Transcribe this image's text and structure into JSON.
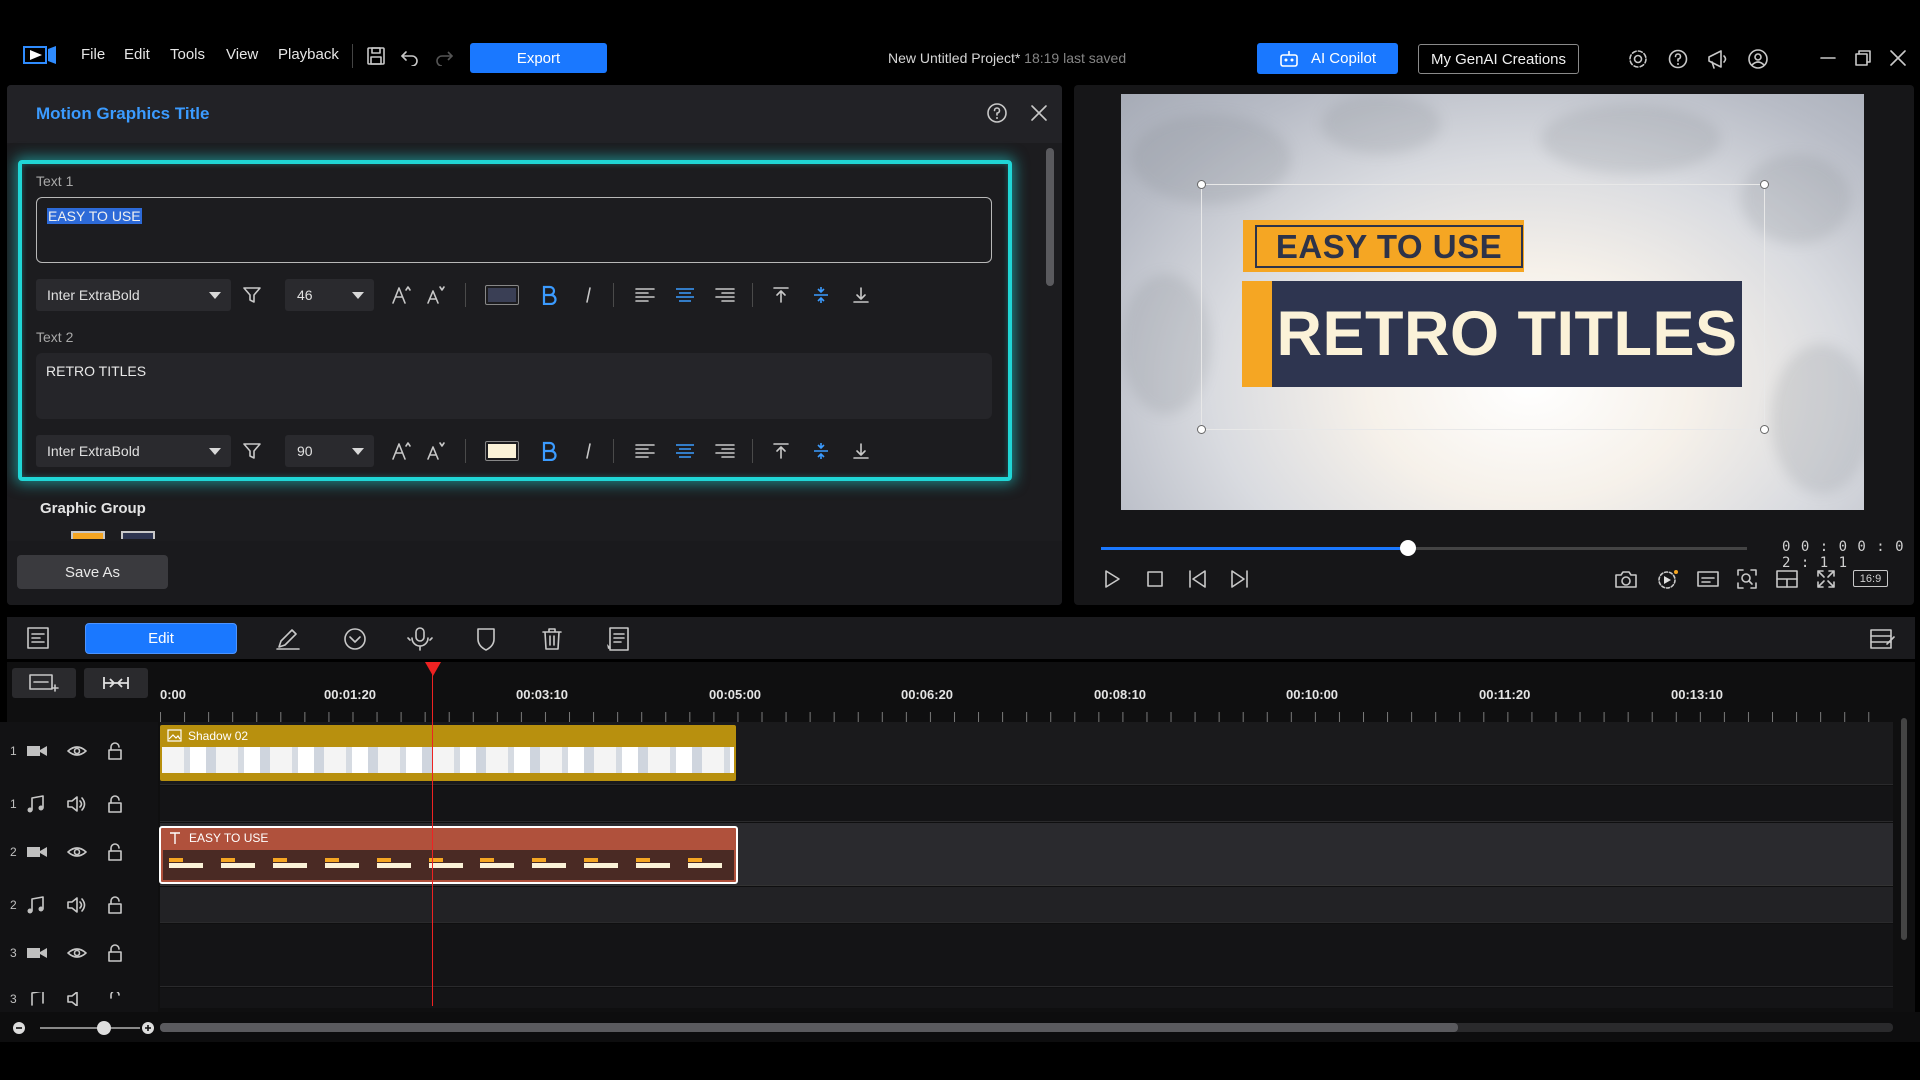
{
  "menu": {
    "items": [
      "File",
      "Edit",
      "Tools",
      "View",
      "Playback"
    ],
    "export_label": "Export"
  },
  "project": {
    "title": "New Untitled Project*",
    "saved": "18:19 last saved"
  },
  "header_buttons": {
    "ai_copilot": "AI Copilot",
    "genai": "My GenAI Creations"
  },
  "panel": {
    "title": "Motion Graphics Title",
    "text1_label": "Text 1",
    "text1_value": "EASY TO USE",
    "text2_label": "Text 2",
    "text2_value": "RETRO TITLES",
    "font1": "Inter ExtraBold",
    "size1": "46",
    "font2": "Inter ExtraBold",
    "size2": "90",
    "group_label": "Graphic Group",
    "save_as": "Save As"
  },
  "colors": {
    "accent_blue": "#1a78ff",
    "glow_cyan": "#20d6d6",
    "title_orange": "#f5a623",
    "title_navy": "#2e3550",
    "title_cream": "#fbf2d8",
    "text1_swatch": "#3a3f55",
    "text2_swatch": "#fbf2d8"
  },
  "preview": {
    "line1": "EASY TO USE",
    "line2": "RETRO TITLES",
    "timecode": "00:00:02:11",
    "aspect": "16:9",
    "progress": 0.475
  },
  "timeline": {
    "edit_label": "Edit",
    "ruler": [
      "0:00",
      "00:01:20",
      "00:03:10",
      "00:05:00",
      "00:06:20",
      "00:08:10",
      "00:10:00",
      "00:11:20",
      "00:13:10"
    ],
    "tracks": [
      {
        "num": "1",
        "kind": "video"
      },
      {
        "num": "1",
        "kind": "audio"
      },
      {
        "num": "2",
        "kind": "video"
      },
      {
        "num": "2",
        "kind": "audio"
      },
      {
        "num": "3",
        "kind": "video"
      },
      {
        "num": "3",
        "kind": "audio"
      }
    ],
    "clip1_label": "Shadow 02",
    "clip2_label": "EASY TO USE"
  }
}
